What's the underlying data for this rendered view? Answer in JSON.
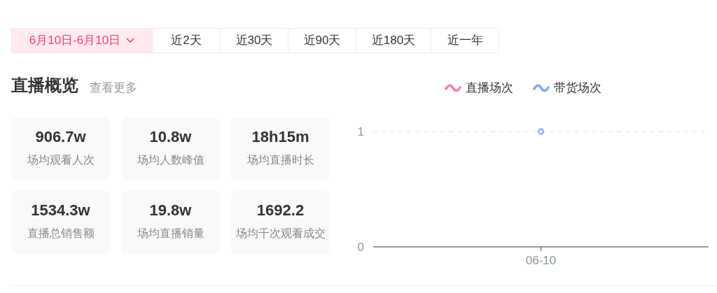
{
  "date_tabs": [
    {
      "label": "6月10日-6月10日",
      "selected": true,
      "dropdown": true
    },
    {
      "label": "近2天",
      "selected": false
    },
    {
      "label": "近30天",
      "selected": false
    },
    {
      "label": "近90天",
      "selected": false
    },
    {
      "label": "近180天",
      "selected": false
    },
    {
      "label": "近一年",
      "selected": false
    }
  ],
  "section": {
    "title": "直播概览",
    "more_link": "查看更多"
  },
  "stats": [
    {
      "value": "906.7w",
      "label": "场均观看人次"
    },
    {
      "value": "10.8w",
      "label": "场均人数峰值"
    },
    {
      "value": "18h15m",
      "label": "场均直播时长"
    },
    {
      "value": "1534.3w",
      "label": "直播总销售额"
    },
    {
      "value": "19.8w",
      "label": "场均直播销量"
    },
    {
      "value": "1692.2",
      "label": "场均千次观看成交"
    }
  ],
  "chart": {
    "chart_data": {
      "type": "line",
      "categories": [
        "06-10"
      ],
      "yticks": [
        0,
        1
      ],
      "ylim": [
        0,
        1
      ],
      "series": [
        {
          "name": "直播场次",
          "color": "#ff7fa0",
          "marker": true,
          "values": [
            null
          ]
        },
        {
          "name": "带货场次",
          "color": "#7fa6ff",
          "marker": true,
          "values": [
            1
          ]
        }
      ]
    }
  }
}
